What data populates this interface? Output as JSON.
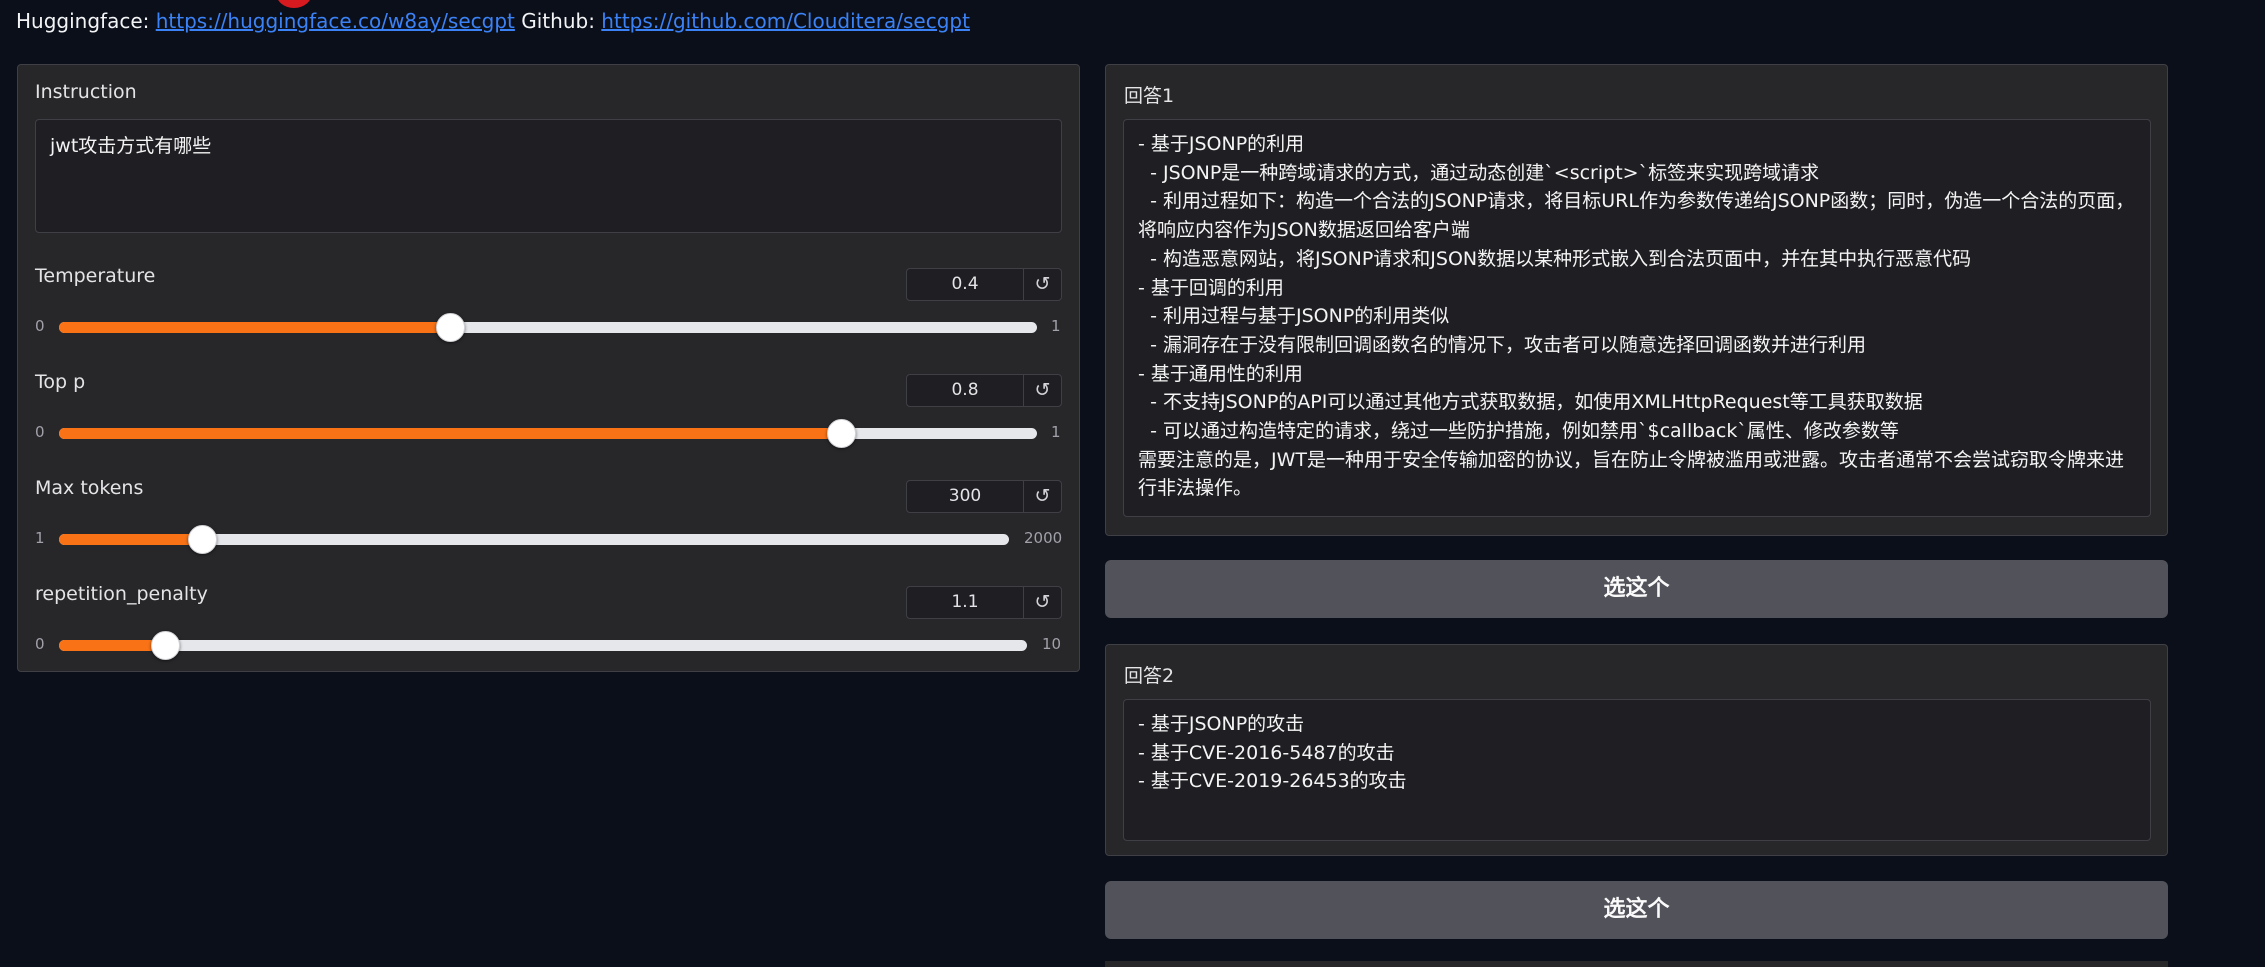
{
  "header": {
    "hf_label": "Huggingface:",
    "hf_link": "https://huggingface.co/w8ay/secgpt",
    "gh_label": "Github:",
    "gh_link": "https://github.com/Clouditera/secgpt"
  },
  "instruction": {
    "label": "Instruction",
    "value": "jwt攻击方式有哪些"
  },
  "sliders": [
    {
      "label": "Temperature",
      "value": "0.4",
      "min": "0",
      "max": "1",
      "fraction": 0.4
    },
    {
      "label": "Top p",
      "value": "0.8",
      "min": "0",
      "max": "1",
      "fraction": 0.8
    },
    {
      "label": "Max tokens",
      "value": "300",
      "min": "1",
      "max": "2000",
      "fraction": 0.15
    },
    {
      "label": "repetition_penalty",
      "value": "1.1",
      "min": "0",
      "max": "10",
      "fraction": 0.11
    }
  ],
  "reset_icon": "↺",
  "answer1": {
    "label": "回答1",
    "text": "- 基于JSONP的利用\n  - JSONP是一种跨域请求的方式，通过动态创建`<script>`标签来实现跨域请求\n  - 利用过程如下：构造一个合法的JSONP请求，将目标URL作为参数传递给JSONP函数；同时，伪造一个合法的页面，将响应内容作为JSON数据返回给客户端\n  - 构造恶意网站，将JSONP请求和JSON数据以某种形式嵌入到合法页面中，并在其中执行恶意代码\n- 基于回调的利用\n  - 利用过程与基于JSONP的利用类似\n  - 漏洞存在于没有限制回调函数名的情况下，攻击者可以随意选择回调函数并进行利用\n- 基于通用性的利用\n  - 不支持JSONP的API可以通过其他方式获取数据，如使用XMLHttpRequest等工具获取数据\n  - 可以通过构造特定的请求，绕过一些防护措施，例如禁用`$callback`属性、修改参数等\n需要注意的是，JWT是一种用于安全传输加密的协议，旨在防止令牌被滥用或泄露。攻击者通常不会尝试窃取令牌来进行非法操作。"
  },
  "answer2": {
    "label": "回答2",
    "text": "- 基于JSONP的攻击\n- 基于CVE-2016-5487的攻击\n- 基于CVE-2019-26453的攻击"
  },
  "choose_label": "选这个",
  "colors": {
    "accent": "#f97316",
    "background": "#0b0f19",
    "panel": "#27272a",
    "button": "#52525b",
    "link": "#3b82f6"
  }
}
